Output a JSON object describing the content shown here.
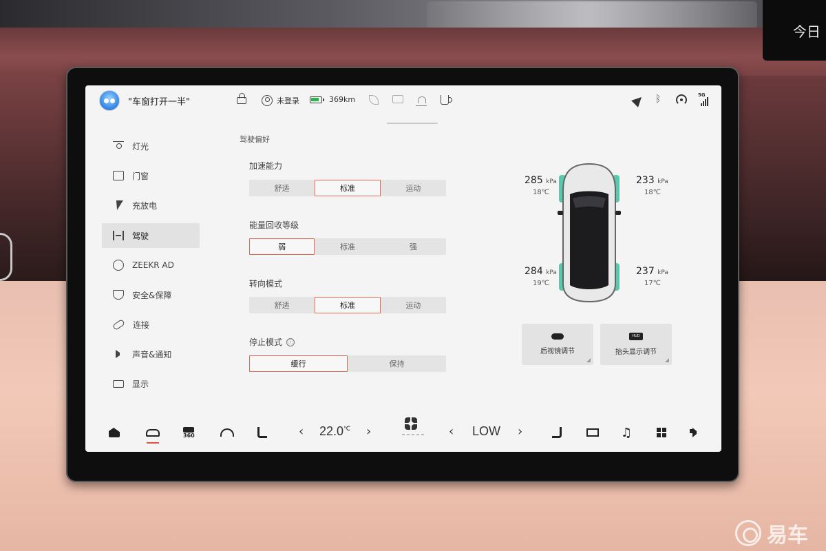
{
  "status_bar": {
    "profile_name": "\"车窗打开一半\"",
    "login_status": "未登录",
    "range": "369km",
    "signal_label": "5G"
  },
  "sidebar": {
    "items": [
      {
        "label": "灯光",
        "icon": "lamp-icon"
      },
      {
        "label": "门窗",
        "icon": "door-icon"
      },
      {
        "label": "充放电",
        "icon": "bolt-icon"
      },
      {
        "label": "驾驶",
        "icon": "chassis-icon",
        "active": true
      },
      {
        "label": "ZEEKR AD",
        "icon": "steering-wheel-icon"
      },
      {
        "label": "安全&保障",
        "icon": "shield-icon"
      },
      {
        "label": "连接",
        "icon": "link-icon"
      },
      {
        "label": "声音&通知",
        "icon": "speaker-icon"
      },
      {
        "label": "显示",
        "icon": "display-icon"
      }
    ]
  },
  "driving": {
    "section_title": "驾驶偏好",
    "acceleration": {
      "label": "加速能力",
      "options": [
        "舒适",
        "标准",
        "运动"
      ],
      "selected": "标准"
    },
    "regen": {
      "label": "能量回收等级",
      "options": [
        "弱",
        "标准",
        "强"
      ],
      "selected": "弱"
    },
    "steering": {
      "label": "转向模式",
      "options": [
        "舒适",
        "标准",
        "运动"
      ],
      "selected": "标准"
    },
    "stop_mode": {
      "label": "停止模式",
      "info_icon": "ⓘ",
      "options": [
        "缓行",
        "保持"
      ],
      "selected": "缓行"
    }
  },
  "tires": {
    "unit": "kPa",
    "front_left": {
      "pressure": "285",
      "temp": "18℃"
    },
    "front_right": {
      "pressure": "233",
      "temp": "18℃"
    },
    "rear_left": {
      "pressure": "284",
      "temp": "19℃"
    },
    "rear_right": {
      "pressure": "237",
      "temp": "17℃"
    }
  },
  "actions": {
    "mirror": "后视镜调节",
    "hud": "抬头显示调节",
    "hud_badge": "HUD"
  },
  "dock": {
    "temperature": "22.0",
    "temp_unit": "℃",
    "fan_level": "LOW",
    "camera_label": "360",
    "left_arrow": "‹",
    "right_arrow": "›",
    "music_glyph": "♫"
  },
  "background": {
    "right_tab_text": "今日",
    "watermark": "易车"
  },
  "colors": {
    "accent": "#e2533f",
    "selected_border": "#e06a55",
    "tire_highlight": "#3fbfa0"
  }
}
